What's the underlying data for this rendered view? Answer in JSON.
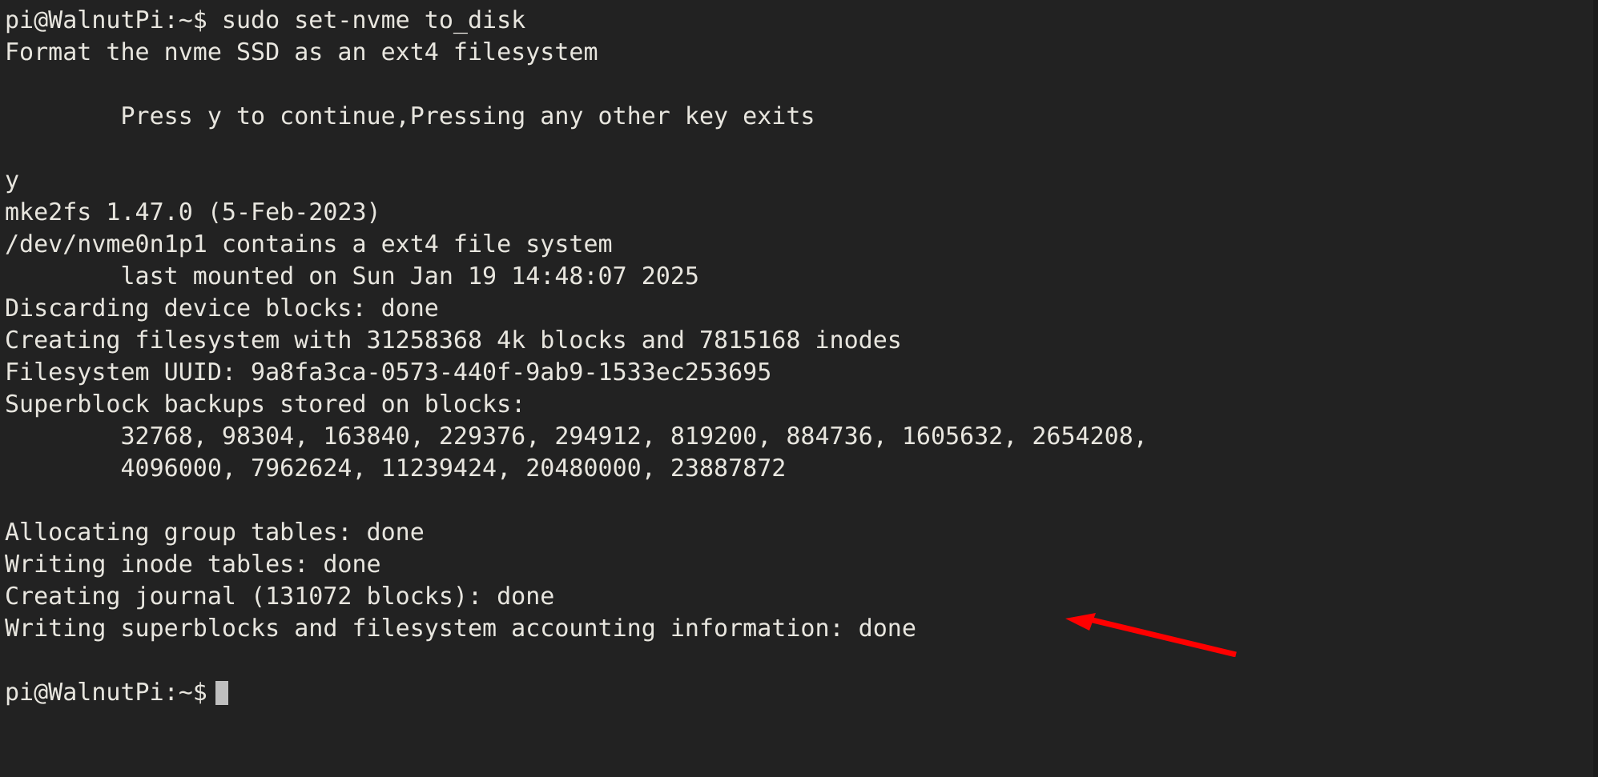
{
  "terminal": {
    "background_color": "#222222",
    "text_color": "#e8e6df",
    "cursor_color": "#bfbfbf",
    "annotation_color": "#ff0000",
    "prompt": "pi@WalnutPi:~$",
    "lines": [
      "pi@WalnutPi:~$ sudo set-nvme to_disk",
      "Format the nvme SSD as an ext4 filesystem",
      "",
      "        Press y to continue,Pressing any other key exits",
      "",
      "y",
      "mke2fs 1.47.0 (5-Feb-2023)",
      "/dev/nvme0n1p1 contains a ext4 file system",
      "        last mounted on Sun Jan 19 14:48:07 2025",
      "Discarding device blocks: done",
      "Creating filesystem with 31258368 4k blocks and 7815168 inodes",
      "Filesystem UUID: 9a8fa3ca-0573-440f-9ab9-1533ec253695",
      "Superblock backups stored on blocks:",
      "        32768, 98304, 163840, 229376, 294912, 819200, 884736, 1605632, 2654208,",
      "        4096000, 7962624, 11239424, 20480000, 23887872",
      "",
      "Allocating group tables: done",
      "Writing inode tables: done",
      "Creating journal (131072 blocks): done",
      "Writing superblocks and filesystem accounting information: done",
      "",
      "pi@WalnutPi:~$"
    ],
    "command": "sudo set-nvme to_disk",
    "annotation": {
      "name": "red-arrow",
      "points_at": "done",
      "direction": "left"
    }
  }
}
